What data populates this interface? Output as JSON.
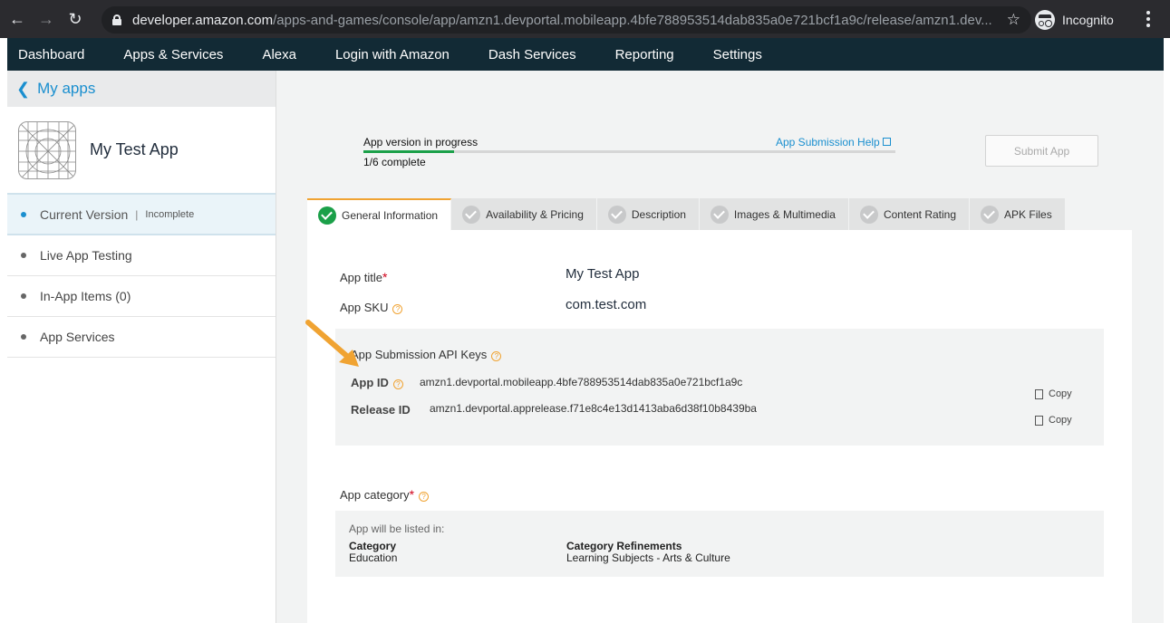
{
  "browser": {
    "url_host": "developer.amazon.com",
    "url_path": "/apps-and-games/console/app/amzn1.devportal.mobileapp.4bfe788953514dab835a0e721bcf1a9c/release/amzn1.dev...",
    "incognito_label": "Incognito"
  },
  "topnav": [
    "Dashboard",
    "Apps & Services",
    "Alexa",
    "Login with Amazon",
    "Dash Services",
    "Reporting",
    "Settings"
  ],
  "sidebar": {
    "back_label": "My apps",
    "app_name": "My Test App",
    "items": [
      {
        "label": "Current Version",
        "sep": "|",
        "status": "Incomplete"
      },
      {
        "label": "Live App Testing"
      },
      {
        "label": "In-App Items (0)"
      },
      {
        "label": "App Services"
      }
    ]
  },
  "progress": {
    "label": "App version in progress",
    "count": "1/6 complete",
    "fraction": 0.17,
    "help_link": "App Submission Help",
    "submit_button": "Submit App"
  },
  "tabs": [
    "General Information",
    "Availability & Pricing",
    "Description",
    "Images & Multimedia",
    "Content Rating",
    "APK Files"
  ],
  "form": {
    "app_title_label": "App title",
    "app_title_value": "My Test App",
    "app_sku_label": "App SKU",
    "app_sku_value": "com.test.com",
    "required_mark": "*",
    "help_mark": "?",
    "keys_title": "App Submission API Keys",
    "app_id_label": "App ID",
    "app_id_value": "amzn1.devportal.mobileapp.4bfe788953514dab835a0e721bcf1a9c",
    "release_id_label": "Release ID",
    "release_id_value": "amzn1.devportal.apprelease.f71e8c4e13d1413aba6d38f10b8439ba",
    "copy_label": "Copy",
    "category_label": "App category",
    "category_note": "App will be listed in:",
    "category_heading": "Category",
    "category_value": "Education",
    "refinements_heading": "Category Refinements",
    "refinements_value": "Learning Subjects - Arts & Culture"
  },
  "colors": {
    "accent": "#1a8fcf",
    "nav_bg": "#122a35",
    "success": "#1ba049",
    "warning": "#f0a332"
  }
}
